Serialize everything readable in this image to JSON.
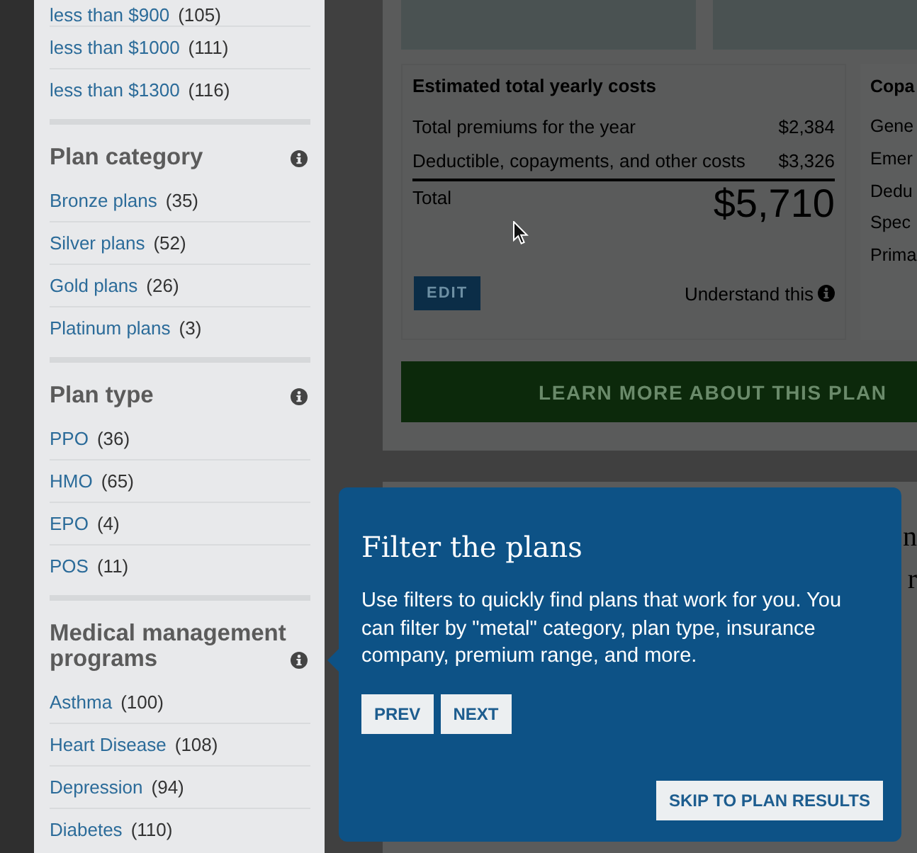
{
  "sidebar": {
    "sections": [
      {
        "items": [
          {
            "label": "less than $900",
            "count": "(105)"
          },
          {
            "label": "less than $1000",
            "count": "(111)"
          },
          {
            "label": "less than $1300",
            "count": "(116)"
          }
        ]
      },
      {
        "heading": "Plan category",
        "items": [
          {
            "label": "Bronze plans",
            "count": "(35)"
          },
          {
            "label": "Silver plans",
            "count": "(52)"
          },
          {
            "label": "Gold plans",
            "count": "(26)"
          },
          {
            "label": "Platinum plans",
            "count": "(3)"
          }
        ]
      },
      {
        "heading": "Plan type",
        "items": [
          {
            "label": "PPO",
            "count": "(36)"
          },
          {
            "label": "HMO",
            "count": "(65)"
          },
          {
            "label": "EPO",
            "count": "(4)"
          },
          {
            "label": "POS",
            "count": "(11)"
          }
        ]
      },
      {
        "heading": "Medical management programs",
        "items": [
          {
            "label": "Asthma",
            "count": "(100)"
          },
          {
            "label": "Heart Disease",
            "count": "(108)"
          },
          {
            "label": "Depression",
            "count": "(94)"
          },
          {
            "label": "Diabetes",
            "count": "(110)"
          }
        ]
      }
    ]
  },
  "plan_card": {
    "cost_panel": {
      "title": "Estimated total yearly costs",
      "rows": [
        {
          "label": "Total premiums for the year",
          "amount": "$2,384"
        },
        {
          "label": "Deductible, copayments, and other costs",
          "amount": "$3,326"
        }
      ],
      "total": {
        "label": "Total",
        "amount": "$5,710"
      },
      "edit_button": "EDIT",
      "help_link": "Understand this"
    },
    "copay_panel": {
      "title": "Copa",
      "rows": [
        "Gene",
        "Emer",
        "Dedu",
        "Spec",
        "Prima"
      ]
    },
    "learn_more_button": "LEARN MORE ABOUT THIS PLAN"
  },
  "next_plan_card": {
    "heading_fragments": [
      "n",
      "r"
    ]
  },
  "tour_popup": {
    "title": "Filter the plans",
    "body": "Use filters to quickly find plans that work for you. You can filter by \"metal\" category, plan type, insurance company, premium range, and more.",
    "buttons": [
      {
        "label": "PREV"
      },
      {
        "label": "NEXT"
      }
    ],
    "skip_button": "SKIP TO PLAN RESULTS"
  }
}
